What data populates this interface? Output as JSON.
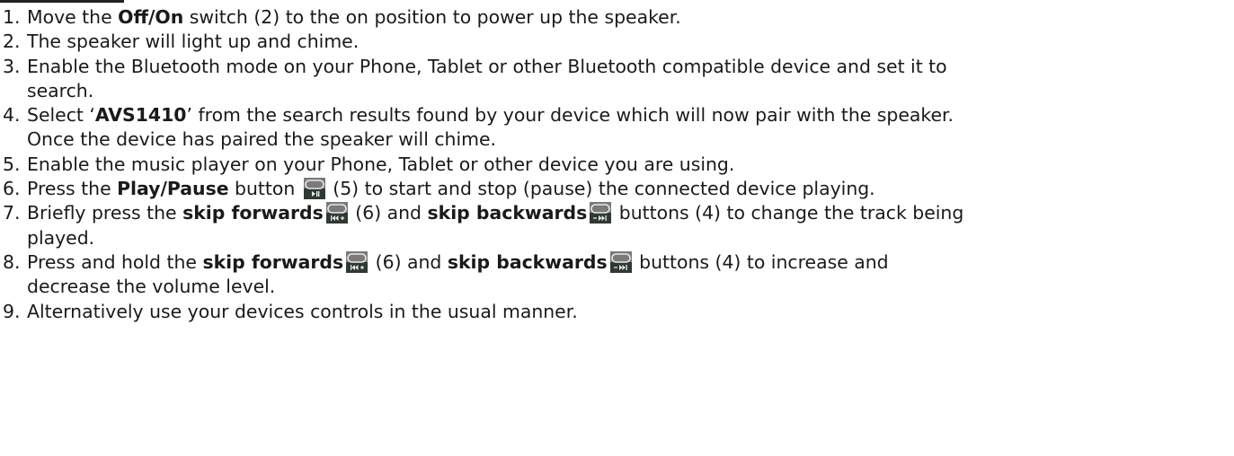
{
  "steps": [
    {
      "number": "1.",
      "text_1": "Move the ",
      "bold_1": "Off/On",
      "text_2": " switch (2) to the on position to power up the speaker."
    },
    {
      "number": "2.",
      "text_1": "The speaker will light up and chime."
    },
    {
      "number": "3.",
      "line_1": "Enable the Bluetooth mode on your Phone, Tablet or other Bluetooth compatible device and set it to",
      "line_2": "search."
    },
    {
      "number": "4.",
      "text_1": "Select ‘",
      "bold_1": "AVS1410",
      "text_2": "’ from the search results found by your device which will now pair with the speaker.",
      "line_2": "Once the device has paired the speaker will chime."
    },
    {
      "number": "5.",
      "text_1": "Enable the music player on your Phone, Tablet or other device you are using."
    },
    {
      "number": "6.",
      "text_1": "Press the ",
      "bold_1": "Play/Pause",
      "text_2": " button ",
      "icon": "play-pause-icon",
      "text_3": " (5) to start and stop (pause) the connected device playing."
    },
    {
      "number": "7.",
      "text_1": "Briefly press the ",
      "bold_1": "skip forwards",
      "icon_1": "skip-forward-icon",
      "text_2": " (6) and ",
      "bold_2": "skip backwards",
      "icon_2": "skip-backward-icon",
      "text_3": " buttons (4) to change the track being",
      "line_2": "played."
    },
    {
      "number": "8.",
      "text_1": "Press and hold the ",
      "bold_1": "skip forwards",
      "icon_1": "skip-forward-icon",
      "text_2": " (6) and ",
      "bold_2": "skip backwards",
      "icon_2": "skip-backward-icon",
      "text_3": " buttons (4) to increase and",
      "line_2": "decrease the volume level."
    },
    {
      "number": "9.",
      "text_1": "Alternatively use your devices controls in the usual manner."
    }
  ],
  "colors": {
    "icon_top": "#7a7a7a",
    "icon_bottom": "#2f3a33",
    "icon_glyph": "#e8e8e8"
  }
}
